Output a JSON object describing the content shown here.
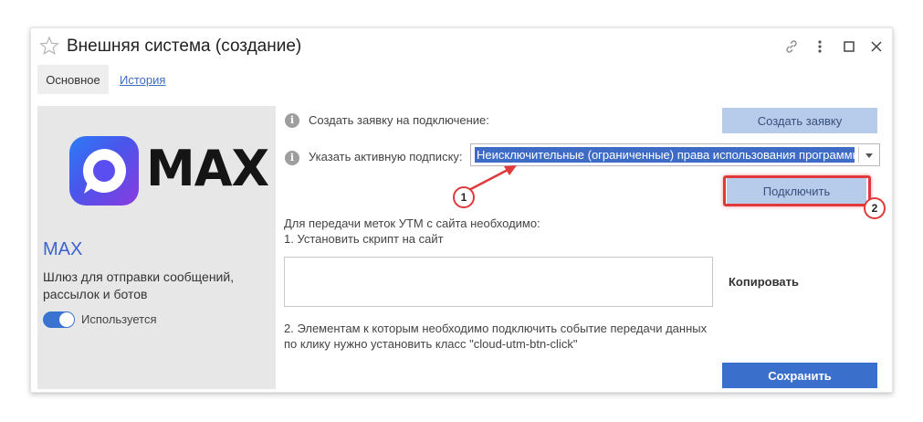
{
  "window": {
    "title": "Внешняя система (создание)"
  },
  "tabs": [
    {
      "label": "Основное",
      "active": true
    },
    {
      "label": "История",
      "active": false
    }
  ],
  "integration": {
    "logo_text": "MAX",
    "name": "MAX",
    "description": "Шлюз для отправки сообщений, рассылок и ботов",
    "toggle_label": "Используется",
    "toggle_on": true
  },
  "form": {
    "request_label": "Создать заявку на подключение:",
    "request_button": "Создать заявку",
    "subscription_label": "Указать активную подписку:",
    "subscription_value": "Неисключительные (ограниченные) права использования программного",
    "connect_button": "Подключить",
    "utm_intro": "Для передачи меток УТМ с сайта необходимо:",
    "utm_step1": "1. Установить скрипт на сайт",
    "copy_button": "Копировать",
    "utm_step2_line1": "2. Элементам к которым необходимо подключить событие передачи данных",
    "utm_step2_line2": "по клику нужно установить класс \"cloud-utm-btn-click\"",
    "save_button": "Сохранить"
  },
  "annotations": [
    {
      "number": "1"
    },
    {
      "number": "2"
    }
  ],
  "colors": {
    "accent": "#3a6fcb",
    "accent_light": "#b7cbea",
    "annotation": "#e0383b",
    "link": "#3c6ec2"
  }
}
